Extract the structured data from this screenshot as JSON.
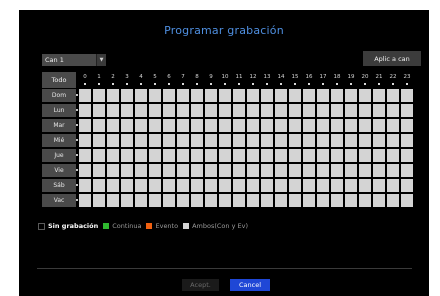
{
  "dialog": {
    "title": "Programar grabación",
    "camera_select": {
      "value": "Can 1"
    },
    "apply_button": "Aplic a can",
    "all_button": "Todo",
    "hours": [
      "0",
      "1",
      "2",
      "3",
      "4",
      "5",
      "6",
      "7",
      "8",
      "9",
      "10",
      "11",
      "12",
      "13",
      "14",
      "15",
      "16",
      "17",
      "18",
      "19",
      "20",
      "21",
      "22",
      "23"
    ],
    "days": [
      "Dom",
      "Lun",
      "Mar",
      "Mié",
      "Jue",
      "Vie",
      "Sáb",
      "Vac"
    ],
    "legend": [
      {
        "label": "Sin grabación",
        "color": "#000000",
        "border": "#5a5a5a"
      },
      {
        "label": "Continua",
        "color": "#2fb82f"
      },
      {
        "label": "Evento",
        "color": "#f06010"
      },
      {
        "label": "Ambos(Con y Ev)",
        "color": "#d4d4d4"
      }
    ],
    "accept_button": "Acept.",
    "cancel_button": "Cancel",
    "colors": {
      "title": "#4f8fe0",
      "cell_empty": "#d4d4d4",
      "cancel_bg": "#1f47d6"
    }
  }
}
